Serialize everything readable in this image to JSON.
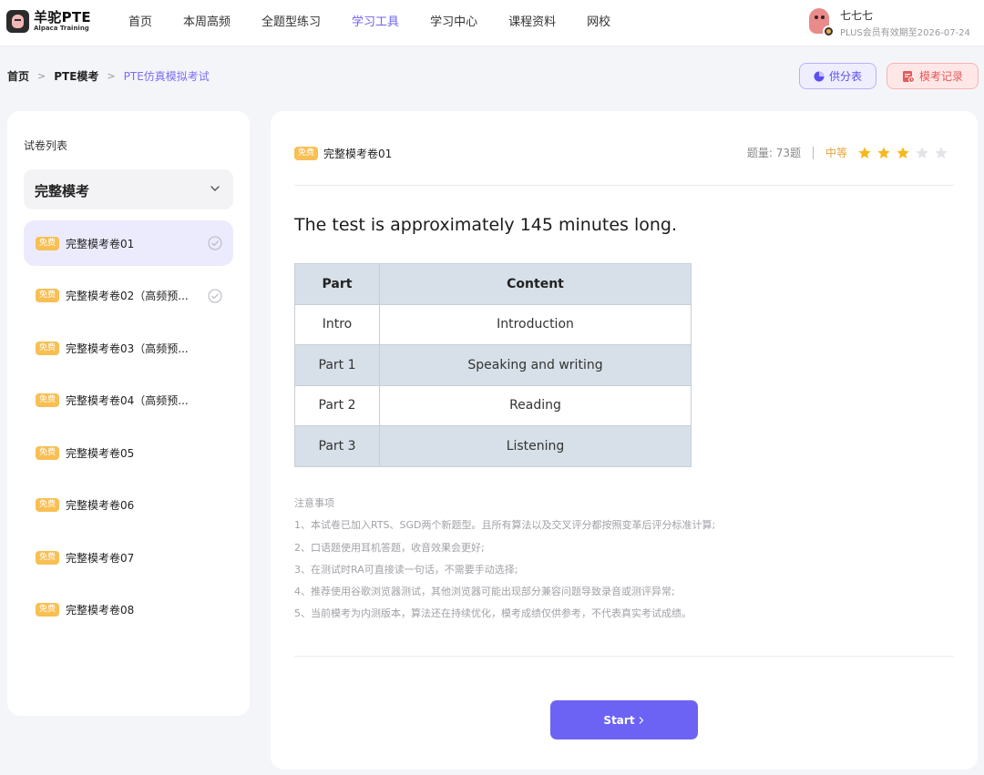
{
  "brand": {
    "name": "羊驼PTE",
    "sub": "Alpaca Training"
  },
  "nav": [
    {
      "label": "首页",
      "active": false
    },
    {
      "label": "本周高频",
      "active": false
    },
    {
      "label": "全题型练习",
      "active": false
    },
    {
      "label": "学习工具",
      "active": true
    },
    {
      "label": "学习中心",
      "active": false
    },
    {
      "label": "课程资料",
      "active": false
    },
    {
      "label": "网校",
      "active": false
    }
  ],
  "user": {
    "name": "七七七",
    "membership": "PLUS会员有效期至2026-07-24"
  },
  "breadcrumb": [
    "首页",
    "PTE模考",
    "PTE仿真模拟考试"
  ],
  "actions": {
    "score_table": "供分表",
    "exam_records": "模考记录"
  },
  "sidebar": {
    "title": "试卷列表",
    "category": "完整模考",
    "papers": [
      {
        "tag": "免费",
        "name": "完整模考卷01",
        "done": true,
        "active": true
      },
      {
        "tag": "免费",
        "name": "完整模考卷02（高频预...",
        "done": true,
        "active": false
      },
      {
        "tag": "免费",
        "name": "完整模考卷03（高频预...",
        "done": false,
        "active": false
      },
      {
        "tag": "免费",
        "name": "完整模考卷04（高频预...",
        "done": false,
        "active": false
      },
      {
        "tag": "免费",
        "name": "完整模考卷05",
        "done": false,
        "active": false
      },
      {
        "tag": "免费",
        "name": "完整模考卷06",
        "done": false,
        "active": false
      },
      {
        "tag": "免费",
        "name": "完整模考卷07",
        "done": false,
        "active": false
      },
      {
        "tag": "免费",
        "name": "完整模考卷08",
        "done": false,
        "active": false
      }
    ]
  },
  "main": {
    "tag": "免费",
    "paper_name": "完整模考卷01",
    "question_count": "题量: 73题",
    "level": "中等",
    "stars_filled": 3,
    "stars_total": 5,
    "heading": "The test is approximately 145 minutes long.",
    "table": {
      "headers": [
        "Part",
        "Content"
      ],
      "rows": [
        [
          "Intro",
          "Introduction"
        ],
        [
          "Part 1",
          "Speaking and writing"
        ],
        [
          "Part 2",
          "Reading"
        ],
        [
          "Part 3",
          "Listening"
        ]
      ]
    },
    "notes_title": "注意事项",
    "notes": [
      "1、本试卷已加入RTS、SGD两个新题型。且所有算法以及交叉评分都按照变革后评分标准计算;",
      "2、口语题使用耳机答题，收音效果会更好;",
      "3、在测试时RA可直接读一句话，不需要手动选择;",
      "4、推荐使用谷歌浏览器测试，其他浏览器可能出现部分兼容问题导致录音或测评异常;",
      "5、当前模考为内测版本，算法还在持续优化，模考成绩仅供参考，不代表真实考试成绩。"
    ],
    "start_label": "Start"
  },
  "colors": {
    "accent": "#6c63f4",
    "tag": "#f8bf53",
    "star": "#f5b81e",
    "star_empty": "#e3e3e8",
    "record": "#e55a5a"
  },
  "icons": {
    "score_table": "pie-chart-icon",
    "exam_records": "record-list-icon",
    "select": "chevron-down-icon",
    "done": "check-circle-icon",
    "start": "chevron-right-icon",
    "rating": "star-icon"
  }
}
